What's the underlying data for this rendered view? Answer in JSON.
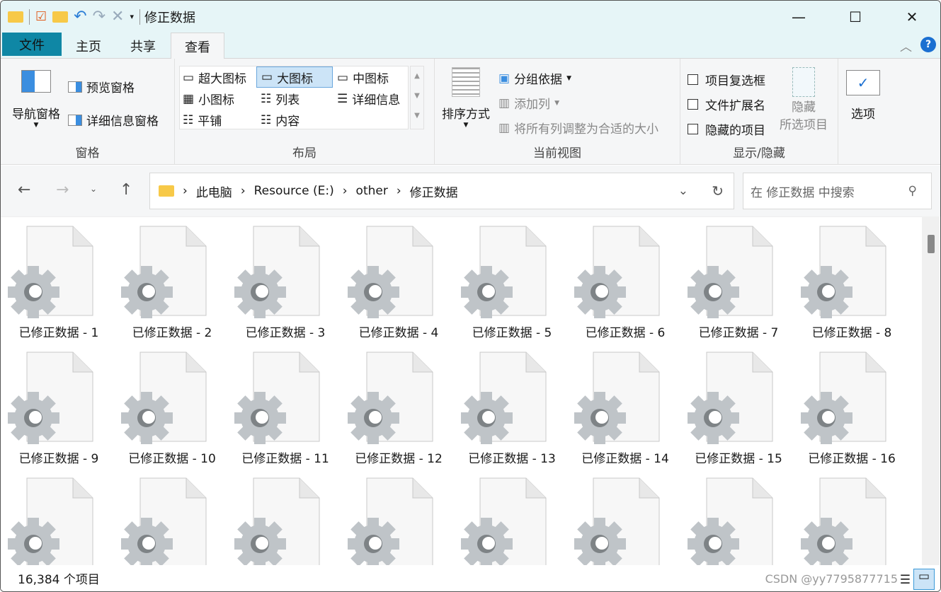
{
  "window": {
    "title": "修正数据"
  },
  "tabs": [
    {
      "label": "文件"
    },
    {
      "label": "主页"
    },
    {
      "label": "共享"
    },
    {
      "label": "查看"
    }
  ],
  "ribbon": {
    "panes": {
      "nav_pane": "导航窗格",
      "preview_pane": "预览窗格",
      "details_pane": "详细信息窗格",
      "group": "窗格"
    },
    "layout": {
      "items": [
        "超大图标",
        "大图标",
        "中图标",
        "小图标",
        "列表",
        "详细信息",
        "平铺",
        "内容"
      ],
      "selected": "大图标",
      "group": "布局"
    },
    "current_view": {
      "sort": "排序方式",
      "group_by": "分组依据",
      "add_column": "添加列",
      "fit_columns": "将所有列调整为合适的大小",
      "group": "当前视图"
    },
    "show_hide": {
      "checkboxes": [
        "项目复选框",
        "文件扩展名",
        "隐藏的项目"
      ],
      "hide_selected_1": "隐藏",
      "hide_selected_2": "所选项目",
      "group": "显示/隐藏"
    },
    "options": "选项"
  },
  "address": {
    "crumbs": [
      "此电脑",
      "Resource (E:)",
      "other",
      "修正数据"
    ]
  },
  "search": {
    "placeholder": "在 修正数据 中搜索"
  },
  "files": [
    "已修正数据 - 1",
    "已修正数据 - 2",
    "已修正数据 - 3",
    "已修正数据 - 4",
    "已修正数据 - 5",
    "已修正数据 - 6",
    "已修正数据 - 7",
    "已修正数据 - 8",
    "已修正数据 - 9",
    "已修正数据 - 10",
    "已修正数据 - 11",
    "已修正数据 - 12",
    "已修正数据 - 13",
    "已修正数据 - 14",
    "已修正数据 - 15",
    "已修正数据 - 16",
    "",
    "",
    "",
    "",
    "",
    "",
    "",
    ""
  ],
  "status": {
    "count": "16,384 个项目"
  },
  "watermark": "CSDN @yy7795877715",
  "colors": {
    "accent": "#0f87a5",
    "selected": "#cce4f7"
  }
}
